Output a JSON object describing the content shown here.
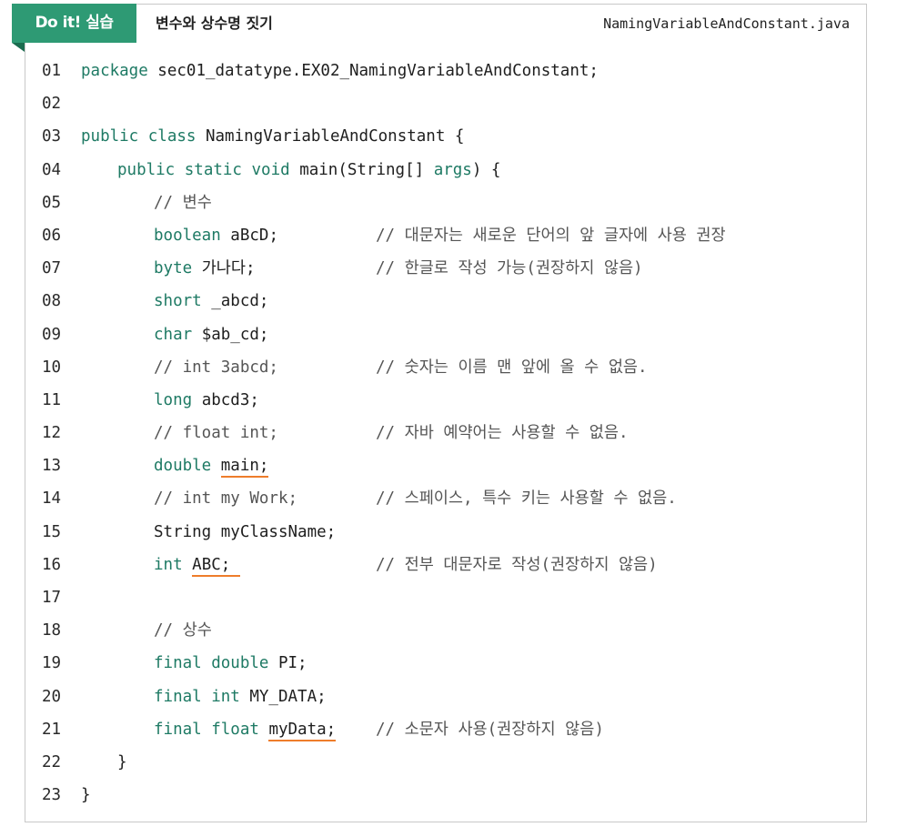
{
  "header": {
    "badge": "Do it! 실습",
    "title": "변수와 상수명 짓기",
    "filename": "NamingVariableAndConstant.java"
  },
  "colors": {
    "accent": "#2e9a74",
    "keyword": "#1e7a64",
    "underline": "#ee7d2b"
  },
  "lines": [
    {
      "n": "01",
      "indent": 0,
      "parts": [
        {
          "t": "package",
          "k": true
        },
        {
          "t": " sec01_datatype.EX02_NamingVariableAndConstant;"
        }
      ]
    },
    {
      "n": "02",
      "indent": 0,
      "parts": []
    },
    {
      "n": "03",
      "indent": 0,
      "parts": [
        {
          "t": "public class",
          "k": true
        },
        {
          "t": " NamingVariableAndConstant {"
        }
      ]
    },
    {
      "n": "04",
      "indent": 1,
      "parts": [
        {
          "t": "public static void",
          "k": true
        },
        {
          "t": " main(String[] "
        },
        {
          "t": "args",
          "k": true
        },
        {
          "t": ") {"
        }
      ]
    },
    {
      "n": "05",
      "indent": 2,
      "parts": [
        {
          "t": "// 변수",
          "c": true
        }
      ]
    },
    {
      "n": "06",
      "indent": 2,
      "parts": [
        {
          "t": "boolean",
          "k": true
        },
        {
          "t": " aBcD;"
        }
      ],
      "comment": "// 대문자는 새로운 단어의 앞 글자에 사용 권장"
    },
    {
      "n": "07",
      "indent": 2,
      "parts": [
        {
          "t": "byte",
          "k": true
        },
        {
          "t": " 가나다;"
        }
      ],
      "comment": "// 한글로 작성 가능(권장하지 않음)"
    },
    {
      "n": "08",
      "indent": 2,
      "parts": [
        {
          "t": "short",
          "k": true
        },
        {
          "t": " _abcd;"
        }
      ]
    },
    {
      "n": "09",
      "indent": 2,
      "parts": [
        {
          "t": "char",
          "k": true
        },
        {
          "t": " $ab_cd;"
        }
      ]
    },
    {
      "n": "10",
      "indent": 2,
      "parts": [
        {
          "t": "// int 3abcd;",
          "c": true
        }
      ],
      "comment": "// 숫자는 이름 맨 앞에 올 수 없음."
    },
    {
      "n": "11",
      "indent": 2,
      "parts": [
        {
          "t": "long",
          "k": true
        },
        {
          "t": " abcd3;"
        }
      ]
    },
    {
      "n": "12",
      "indent": 2,
      "parts": [
        {
          "t": "// float int;",
          "c": true
        }
      ],
      "comment": "// 자바 예약어는 사용할 수 없음."
    },
    {
      "n": "13",
      "indent": 2,
      "parts": [
        {
          "t": "double",
          "k": true
        },
        {
          "t": " "
        },
        {
          "t": "main;",
          "u": true
        }
      ]
    },
    {
      "n": "14",
      "indent": 2,
      "parts": [
        {
          "t": "// int my Work;",
          "c": true
        }
      ],
      "comment": "// 스페이스, 특수 키는 사용할 수 없음."
    },
    {
      "n": "15",
      "indent": 2,
      "parts": [
        {
          "t": "String myClassName;"
        }
      ]
    },
    {
      "n": "16",
      "indent": 2,
      "parts": [
        {
          "t": "int",
          "k": true
        },
        {
          "t": " "
        },
        {
          "t": "ABC; ",
          "u": true
        }
      ],
      "comment": "// 전부 대문자로 작성(권장하지 않음)"
    },
    {
      "n": "17",
      "indent": 0,
      "parts": []
    },
    {
      "n": "18",
      "indent": 2,
      "parts": [
        {
          "t": "// 상수",
          "c": true
        }
      ]
    },
    {
      "n": "19",
      "indent": 2,
      "parts": [
        {
          "t": "final double",
          "k": true
        },
        {
          "t": " PI;"
        }
      ]
    },
    {
      "n": "20",
      "indent": 2,
      "parts": [
        {
          "t": "final int",
          "k": true
        },
        {
          "t": " MY_DATA;"
        }
      ]
    },
    {
      "n": "21",
      "indent": 2,
      "parts": [
        {
          "t": "final float",
          "k": true
        },
        {
          "t": " "
        },
        {
          "t": "myData;",
          "u": true
        }
      ],
      "comment": "// 소문자 사용(권장하지 않음)"
    },
    {
      "n": "22",
      "indent": 1,
      "parts": [
        {
          "t": "}"
        }
      ]
    },
    {
      "n": "23",
      "indent": 0,
      "parts": [
        {
          "t": "}"
        }
      ]
    }
  ]
}
